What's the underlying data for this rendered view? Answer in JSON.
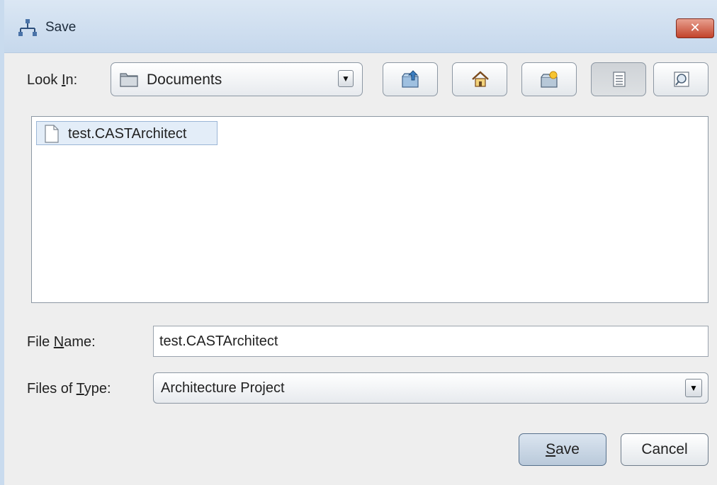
{
  "window": {
    "title": "Save",
    "close_glyph": "✕"
  },
  "look_in": {
    "label_pre": "Look ",
    "label_mn": "I",
    "label_post": "n:",
    "value": "Documents",
    "icon": "folder-icon"
  },
  "toolbar": {
    "buttons": [
      {
        "name": "up-one-level-button",
        "icon": "folder-up-icon"
      },
      {
        "name": "home-button",
        "icon": "home-icon"
      },
      {
        "name": "new-folder-button",
        "icon": "new-folder-icon"
      },
      {
        "name": "list-view-button",
        "icon": "list-view-icon",
        "pressed": true
      },
      {
        "name": "details-view-button",
        "icon": "details-view-icon"
      }
    ]
  },
  "file_list": {
    "items": [
      {
        "name": "test.CASTArchitect",
        "icon": "file-icon",
        "selected": true
      }
    ]
  },
  "file_name": {
    "label_pre": "File ",
    "label_mn": "N",
    "label_post": "ame:",
    "value": "test.CASTArchitect"
  },
  "file_type": {
    "label_pre": "Files of ",
    "label_mn": "T",
    "label_post": "ype:",
    "value": "Architecture Project"
  },
  "buttons": {
    "save_mn": "S",
    "save_rest": "ave",
    "cancel": "Cancel"
  },
  "colors": {
    "titlebar": "#c6d8ec",
    "close": "#c2432b",
    "selection": "#e3edf8"
  }
}
